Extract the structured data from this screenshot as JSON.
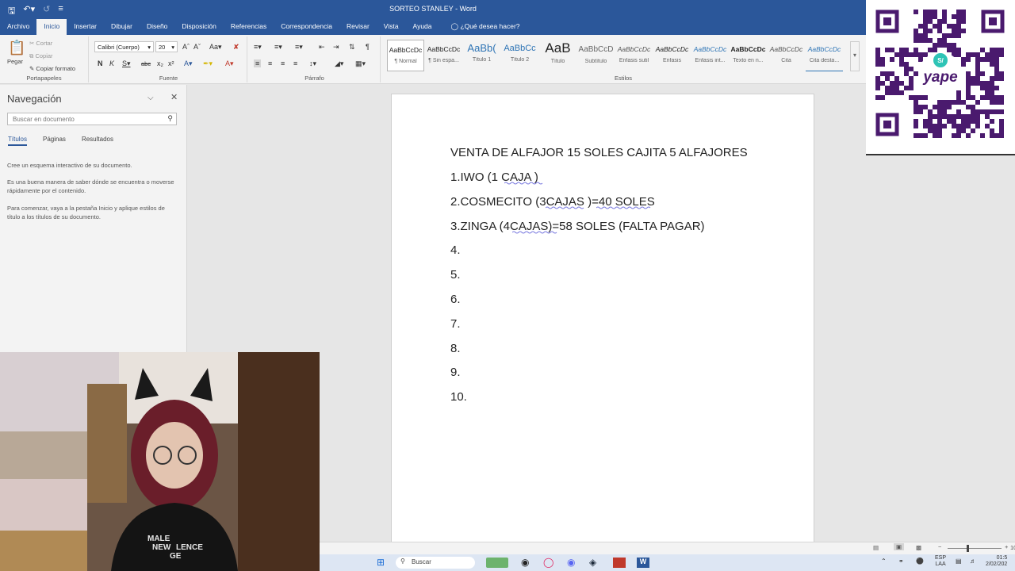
{
  "app": {
    "title": "SORTEO STANLEY  -  Word"
  },
  "tabs": [
    "Archivo",
    "Inicio",
    "Insertar",
    "Dibujar",
    "Diseño",
    "Disposición",
    "Referencias",
    "Correspondencia",
    "Revisar",
    "Vista",
    "Ayuda"
  ],
  "tell_me": "¿Qué desea hacer?",
  "ribbon": {
    "clipboard": {
      "paste": "Pegar",
      "cut": "Cortar",
      "copy": "Copiar",
      "format_painter": "Copiar formato",
      "label": "Portapapeles"
    },
    "font": {
      "family": "Calibri (Cuerpo)",
      "size": "20",
      "label": "Fuente"
    },
    "paragraph": {
      "label": "Párrafo"
    },
    "styles": {
      "label": "Estilos",
      "items": [
        {
          "preview": "AaBbCcDc",
          "name": "¶ Normal"
        },
        {
          "preview": "AaBbCcDc",
          "name": "¶ Sin espa..."
        },
        {
          "preview": "AaBb(",
          "name": "Título 1"
        },
        {
          "preview": "AaBbCc",
          "name": "Título 2"
        },
        {
          "preview": "AaB",
          "name": "Título"
        },
        {
          "preview": "AaBbCcD",
          "name": "Subtítulo"
        },
        {
          "preview": "AaBbCcDc",
          "name": "Énfasis sutil"
        },
        {
          "preview": "AaBbCcDc",
          "name": "Énfasis"
        },
        {
          "preview": "AaBbCcDc",
          "name": "Énfasis int..."
        },
        {
          "preview": "AaBbCcDc",
          "name": "Texto en n..."
        },
        {
          "preview": "AaBbCcDc",
          "name": "Cita"
        },
        {
          "preview": "AaBbCcDc",
          "name": "Cita desta..."
        }
      ]
    }
  },
  "navigation": {
    "title": "Navegación",
    "search_placeholder": "Buscar en documento",
    "tabs": [
      "Títulos",
      "Páginas",
      "Resultados"
    ],
    "texts": [
      "Cree un esquema interactivo de su documento.",
      "Es una buena manera de saber dónde se encuentra o moverse rápidamente por el contenido.",
      "Para comenzar, vaya a la pestaña Inicio y aplique estilos de título a los títulos de su documento."
    ]
  },
  "document": {
    "lines": [
      "VENTA DE ALFAJOR 15 SOLES CAJITA 5 ALFAJORES",
      "1.IWO (1 CAJA )",
      "2.COSMECITO (3CAJAS )=40  SOLES",
      "3.ZINGA (4CAJAS)=58 SOLES (FALTA PAGAR)",
      "4.",
      "5.",
      "6.",
      "7.",
      "8.",
      "9.",
      "10."
    ]
  },
  "qr": {
    "brand": "yape",
    "currency": "S/"
  },
  "webcam": {
    "shirt_text_1": "MALE",
    "shirt_text_2": "NEW",
    "shirt_text_3": "LENCE",
    "shirt_text_4": "GE"
  },
  "statusbar": {
    "zoom": "10"
  },
  "taskbar": {
    "search": "Buscar",
    "lang_1": "ESP",
    "lang_2": "LAA",
    "time": "01:5",
    "date": "2/02/202"
  },
  "colors": {
    "word_blue": "#2b579a",
    "yape_purple": "#4a1a6e"
  }
}
